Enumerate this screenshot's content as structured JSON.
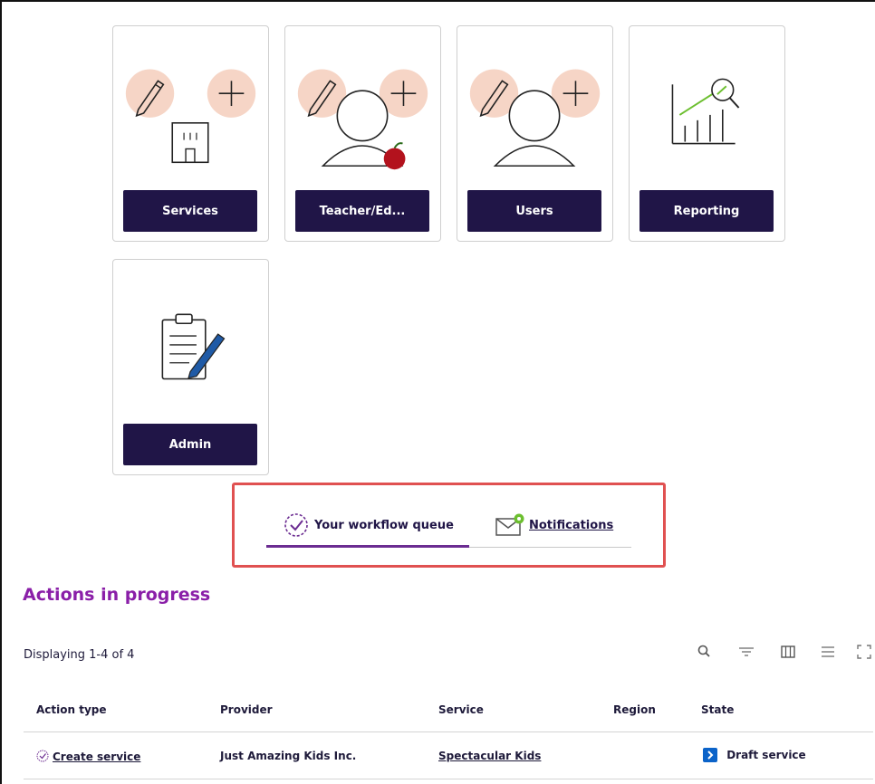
{
  "tiles": [
    {
      "label": "Services"
    },
    {
      "label": "Teacher/Ed..."
    },
    {
      "label": "Users"
    },
    {
      "label": "Reporting"
    },
    {
      "label": "Admin"
    }
  ],
  "tabs": [
    {
      "label": "Your workflow queue"
    },
    {
      "label": "Notifications"
    }
  ],
  "section_title": "Actions in progress",
  "display_count": "Displaying 1-4 of 4",
  "table": {
    "columns": [
      "Action type",
      "Provider",
      "Service",
      "Region",
      "State"
    ],
    "rows": [
      {
        "action_type": "Create service",
        "provider": "Just Amazing Kids Inc.",
        "service": "Spectacular Kids",
        "region": "",
        "state": "Draft service"
      }
    ]
  },
  "colors": {
    "accent": "#201547",
    "purple": "#8a1fa8",
    "highlight_border": "#e05151",
    "peach": "#f6d5c6",
    "state_blue": "#0b63c9"
  }
}
